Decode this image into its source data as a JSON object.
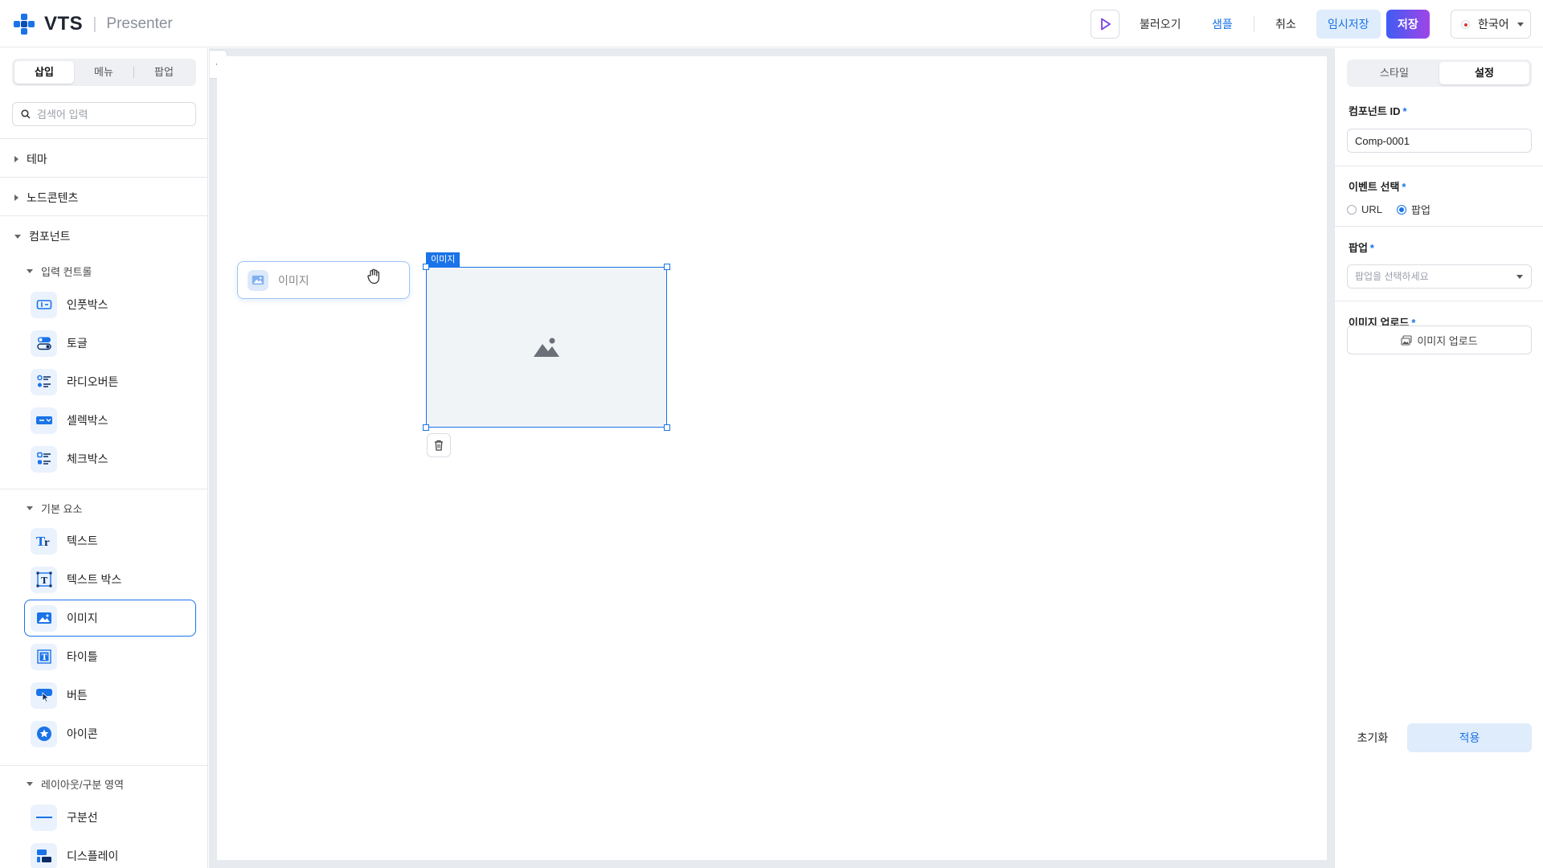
{
  "header": {
    "logo_text": "VTS",
    "logo_separator": "|",
    "logo_subtitle": "Presenter",
    "load_label": "불러오기",
    "sample_label": "샘플",
    "cancel_label": "취소",
    "temp_save_label": "임시저장",
    "save_label": "저장",
    "language_label": "한국어"
  },
  "left_panel": {
    "tabs": [
      {
        "label": "삽입"
      },
      {
        "label": "메뉴"
      },
      {
        "label": "팝업"
      }
    ],
    "search_placeholder": "검색어 입력",
    "sections": {
      "theme": "테마",
      "node_contents": "노드콘텐츠",
      "component": "컴포넌트"
    },
    "groups": {
      "input_controls": "입력 컨트롤",
      "basic_elements": "기본 요소",
      "layout": "레이아웃/구분 영역"
    },
    "items": {
      "inputbox": "인풋박스",
      "toggle": "토글",
      "radio": "라디오버튼",
      "selectbox": "셀렉박스",
      "checkbox": "체크박스",
      "text": "텍스트",
      "textbox": "텍스트 박스",
      "image": "이미지",
      "title": "타이틀",
      "button": "버튼",
      "icon": "아이콘",
      "divider": "구분선",
      "display": "디스플레이"
    }
  },
  "canvas": {
    "ghost_label": "이미지",
    "selected_tag": "이미지"
  },
  "right_panel": {
    "tabs": [
      {
        "label": "스타일"
      },
      {
        "label": "설정"
      }
    ],
    "component_id_label": "컴포넌트 ID",
    "component_id_value": "Comp-0001",
    "required_mark": "*",
    "event_label": "이벤트 선택",
    "event_options": [
      {
        "label": "URL"
      },
      {
        "label": "팝업"
      }
    ],
    "popup_label": "팝업",
    "popup_placeholder": "팝업을 선택하세요",
    "image_upload_label": "이미지 업로드",
    "image_upload_button": "이미지 업로드",
    "reset_label": "초기화",
    "apply_label": "적용"
  },
  "colors": {
    "accent": "#1a73e8",
    "save_gradient_start": "#3f5cf2",
    "save_gradient_end": "#a045e8"
  }
}
